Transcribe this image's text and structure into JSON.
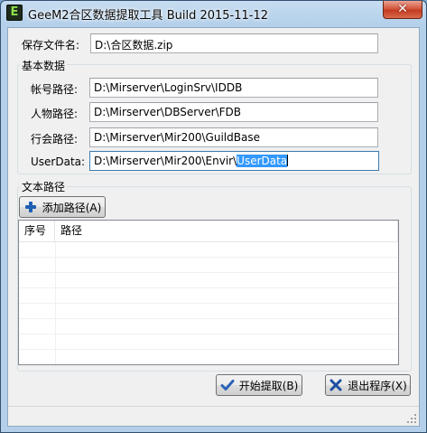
{
  "window": {
    "title": "GeeM2合区数据提取工具 Build 2015-11-12",
    "icon_letter": "E",
    "close_label": "✕"
  },
  "save_file": {
    "label": "保存文件名:",
    "value": "D:\\合区数据.zip"
  },
  "basic_group": {
    "title": "基本数据",
    "fields": [
      {
        "label": "帐号路径:",
        "value": "D:\\Mirserver\\LoginSrv\\IDDB"
      },
      {
        "label": "人物路径:",
        "value": "D:\\Mirserver\\DBServer\\FDB"
      },
      {
        "label": "行会路径:",
        "value": "D:\\Mirserver\\Mir200\\GuildBase"
      },
      {
        "label": "UserData:",
        "value_prefix": "D:\\Mirserver\\Mir200\\Envir\\",
        "value_selected": "UserData"
      }
    ]
  },
  "text_group": {
    "title": "文本路径",
    "add_button_label": "添加路径(A)",
    "columns": [
      "序号",
      "路径"
    ],
    "rows": []
  },
  "buttons": {
    "start_label": "开始提取(B)",
    "exit_label": "退出程序(X)"
  },
  "colors": {
    "selection": "#3399ff",
    "plus_icon": "#1f5fb4",
    "check_icon": "#2b62b8",
    "x_icon": "#1d4fa0"
  }
}
